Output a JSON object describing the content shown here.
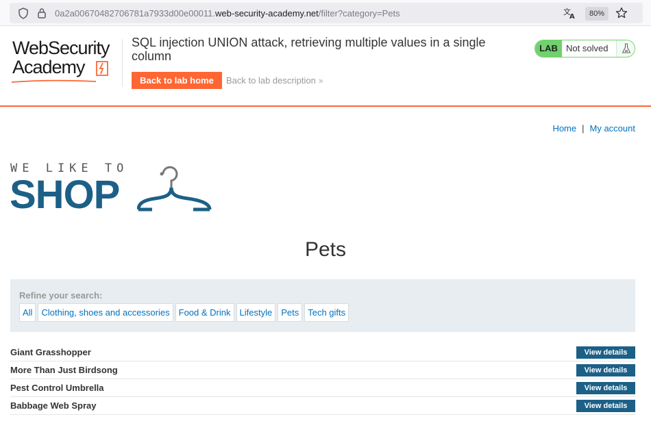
{
  "browser": {
    "url_prefix": "0a2a00670482706781a7933d00e00011.",
    "url_domain": "web-security-academy.net",
    "url_path": "/filter?category=Pets",
    "zoom": "80%",
    "icons": [
      "shield-icon",
      "lock-icon",
      "translate-icon",
      "star-icon"
    ]
  },
  "lab_header": {
    "logo_line1": "WebSecurity",
    "logo_line2": "Academy",
    "title": "SQL injection UNION attack, retrieving multiple values in a single column",
    "back_home_label": "Back to lab home",
    "back_description_label": "Back to lab description",
    "lab_tag": "LAB",
    "status": "Not solved",
    "accent_color": "#ff6633",
    "status_color": "#70d16d"
  },
  "nav": {
    "home": "Home",
    "separator": "|",
    "account": "My account"
  },
  "shop_logo": {
    "small_text": "WE LIKE TO",
    "big_text": "SHOP"
  },
  "page": {
    "title": "Pets"
  },
  "refine": {
    "label": "Refine your search:",
    "filters": [
      "All",
      "Clothing, shoes and accessories",
      "Food & Drink",
      "Lifestyle",
      "Pets",
      "Tech gifts"
    ]
  },
  "products": [
    {
      "name": "Giant Grasshopper",
      "button": "View details"
    },
    {
      "name": "More Than Just Birdsong",
      "button": "View details"
    },
    {
      "name": "Pest Control Umbrella",
      "button": "View details"
    },
    {
      "name": "Babbage Web Spray",
      "button": "View details"
    }
  ]
}
